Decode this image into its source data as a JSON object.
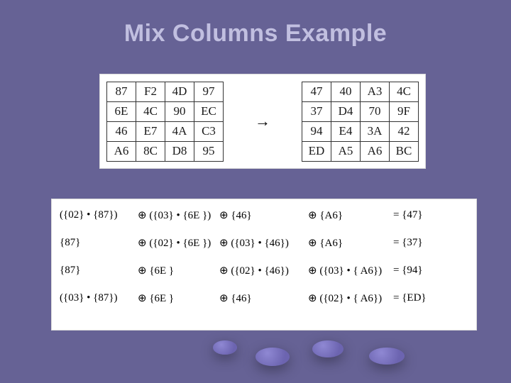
{
  "title": "Mix Columns Example",
  "arrow": "→",
  "left_matrix": [
    [
      "87",
      "F2",
      "4D",
      "97"
    ],
    [
      "6E",
      "4C",
      "90",
      "EC"
    ],
    [
      "46",
      "E7",
      "4A",
      "C3"
    ],
    [
      "A6",
      "8C",
      "D8",
      "95"
    ]
  ],
  "right_matrix": [
    [
      "47",
      "40",
      "A3",
      "4C"
    ],
    [
      "37",
      "D4",
      "70",
      "9F"
    ],
    [
      "94",
      "E4",
      "3A",
      "42"
    ],
    [
      "ED",
      "A5",
      "A6",
      "BC"
    ]
  ],
  "equations": [
    {
      "c1": "({02} • {87})",
      "c2": "⊕ ({03} • {6E })",
      "c3": "⊕ {46}",
      "c4": "⊕ {A6}",
      "c5": "= {47}"
    },
    {
      "c1": "{87}",
      "c2": "⊕ ({02} • {6E })",
      "c3": "⊕ ({03} • {46})",
      "c4": "⊕ {A6}",
      "c5": "= {37}"
    },
    {
      "c1": "{87}",
      "c2": "⊕ {6E }",
      "c3": "⊕ ({02} • {46})",
      "c4": "⊕ ({03} • { A6})",
      "c5": "= {94}"
    },
    {
      "c1": "({03} • {87})",
      "c2": "⊕ {6E }",
      "c3": "⊕ {46}",
      "c4": "⊕ ({02} • { A6})",
      "c5": "= {ED}"
    }
  ]
}
